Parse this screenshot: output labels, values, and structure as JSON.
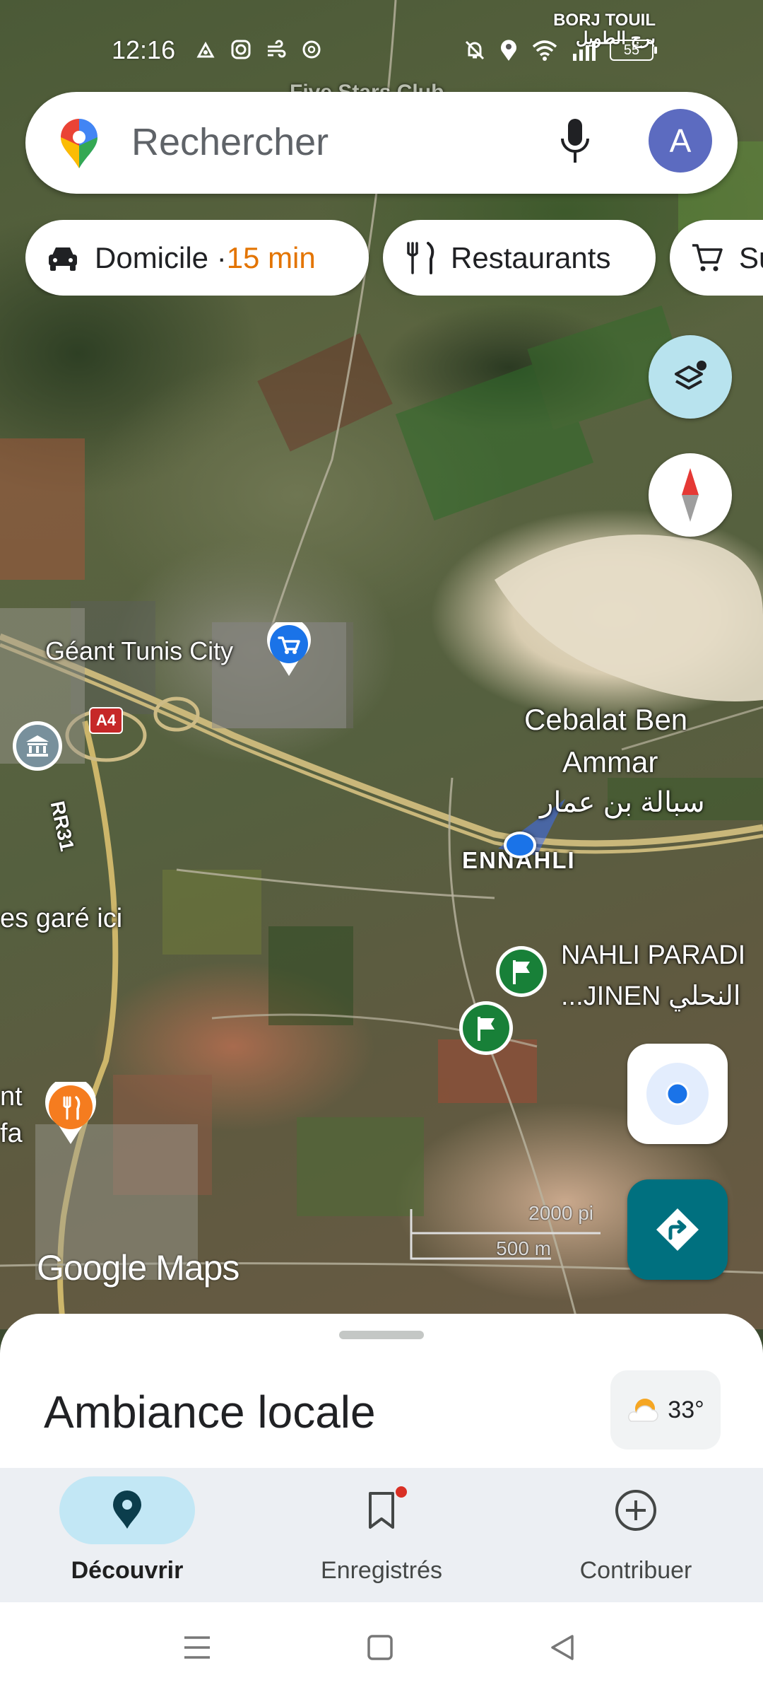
{
  "status_bar": {
    "time": "12:16",
    "battery": "55",
    "city_latin": "BORJ TOUIL",
    "city_arabic": "برج الطويل"
  },
  "search": {
    "placeholder": "Rechercher",
    "avatar_initial": "A"
  },
  "chips": [
    {
      "label": "Domicile · ",
      "eta": "15 min",
      "icon": "car-icon"
    },
    {
      "label": "Restaurants",
      "icon": "fork-knife-icon"
    },
    {
      "label": "Su",
      "icon": "cart-icon"
    }
  ],
  "map": {
    "labels": {
      "mall": "Géant Tunis City",
      "town_latin_1": "Cebalat Ben",
      "town_latin_2": "Ammar",
      "town_arabic": "سبالة بن عمار",
      "district": "ENNAHLI",
      "park_1": "NAHLI PARADI",
      "park_2": "...JINEN النحلي",
      "parked": "es garé ici",
      "restaurant_1": "nt",
      "restaurant_2": "fa",
      "road_a4": "A4",
      "road_rr31": "RR31",
      "top_partial": "Five Stars Club"
    },
    "scale": {
      "imperial": "2000 pi",
      "metric": "500 m"
    },
    "watermark": "Google Maps",
    "colors": {
      "teal_button": "#00707f",
      "layers_bg": "#b8e3ee",
      "location_dot": "#1a73e8"
    }
  },
  "sheet": {
    "title": "Ambiance locale",
    "weather": "33°"
  },
  "bottom_nav": [
    {
      "label": "Découvrir",
      "icon": "explore-pin-icon",
      "active": true
    },
    {
      "label": "Enregistrés",
      "icon": "bookmark-icon",
      "active": false
    },
    {
      "label": "Contribuer",
      "icon": "add-circle-icon",
      "active": false
    }
  ]
}
